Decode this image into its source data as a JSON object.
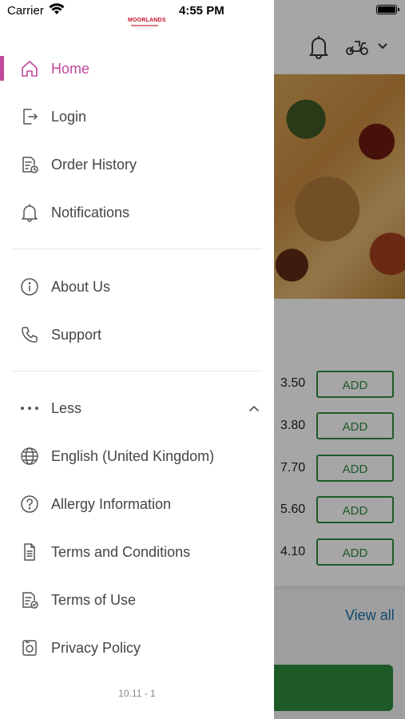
{
  "status_bar": {
    "carrier": "Carrier",
    "time": "4:55 PM"
  },
  "brand": {
    "logo_text": "MOORLANDS",
    "accent_color": "#c0489a"
  },
  "menu": {
    "primary": [
      {
        "label": "Home",
        "icon": "home-icon",
        "active": true
      },
      {
        "label": "Login",
        "icon": "login-icon"
      },
      {
        "label": "Order History",
        "icon": "order-history-icon"
      },
      {
        "label": "Notifications",
        "icon": "bell-icon"
      }
    ],
    "secondary": [
      {
        "label": "About Us",
        "icon": "info-icon"
      },
      {
        "label": "Support",
        "icon": "phone-icon"
      }
    ],
    "more": [
      {
        "label": "Less",
        "icon": "more-dots-icon"
      },
      {
        "label": "English (United Kingdom)",
        "icon": "globe-icon"
      },
      {
        "label": "Allergy Information",
        "icon": "question-icon"
      },
      {
        "label": "Terms and Conditions",
        "icon": "document-icon"
      },
      {
        "label": "Terms of Use",
        "icon": "document-check-icon"
      },
      {
        "label": "Privacy Policy",
        "icon": "privacy-icon"
      }
    ],
    "version": "10.11 - 1"
  },
  "background": {
    "prices": [
      "3.50",
      "3.80",
      "7.70",
      "5.60",
      "4.10"
    ],
    "add_label": "ADD",
    "view_all": "View all"
  }
}
